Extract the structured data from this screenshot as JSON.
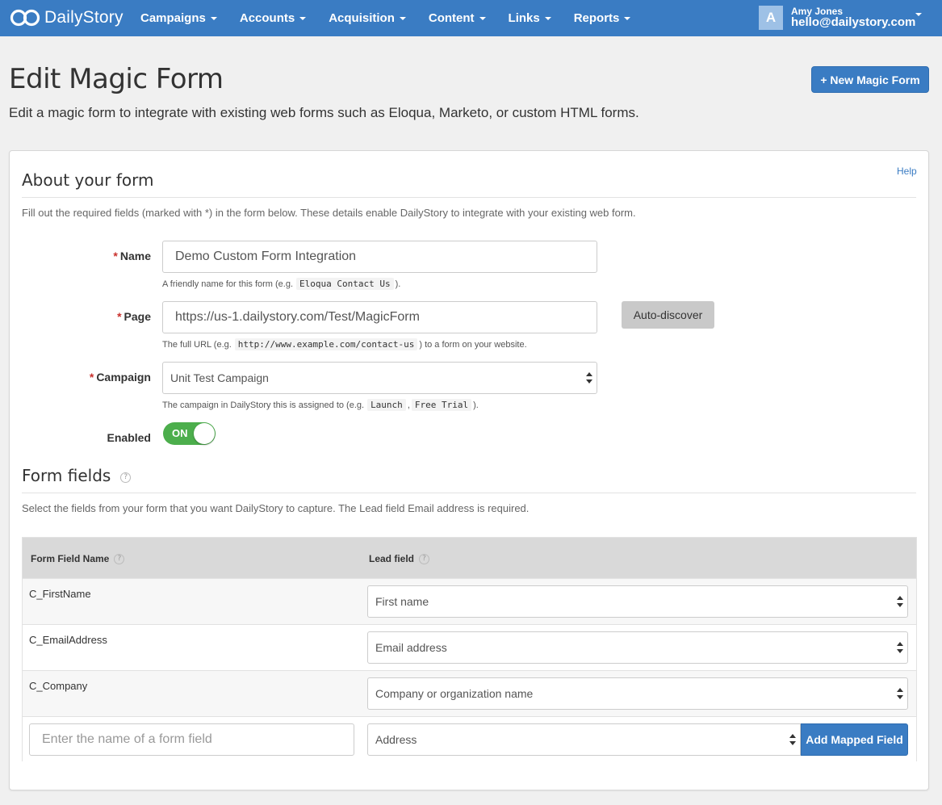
{
  "brand": {
    "name": "DailyStory",
    "logo_icon": "infinity-logo"
  },
  "nav": {
    "items": [
      {
        "label": "Campaigns"
      },
      {
        "label": "Accounts"
      },
      {
        "label": "Acquisition"
      },
      {
        "label": "Content"
      },
      {
        "label": "Links"
      },
      {
        "label": "Reports"
      }
    ]
  },
  "user": {
    "initial": "A",
    "name": "Amy Jones",
    "email": "hello@dailystory.com"
  },
  "header": {
    "title": "Edit Magic Form",
    "description": "Edit a magic form to integrate with existing web forms such as Eloqua, Marketo, or custom HTML forms.",
    "new_button": "+ New Magic Form"
  },
  "about": {
    "title": "About your form",
    "help": "Help",
    "description": "Fill out the required fields (marked with *) in the form below. These details enable DailyStory to integrate with your existing web form.",
    "required_mark": "*",
    "name": {
      "label": "Name",
      "value": "Demo Custom Form Integration",
      "hint_pre": "A friendly name for this form (e.g.",
      "hint_code": "Eloqua Contact Us",
      "hint_post": ")."
    },
    "page": {
      "label": "Page",
      "value": "https://us-1.dailystory.com/Test/MagicForm",
      "hint_pre": "The full URL (e.g.",
      "hint_code": "http://www.example.com/contact-us",
      "hint_post": ") to a form on your website.",
      "button": "Auto-discover"
    },
    "campaign": {
      "label": "Campaign",
      "value": "Unit Test Campaign",
      "hint_pre": "The campaign in DailyStory this is assigned to (e.g.",
      "hint_code1": "Launch",
      "hint_sep": ",",
      "hint_code2": "Free Trial",
      "hint_post": ")."
    },
    "enabled": {
      "label": "Enabled",
      "state": "ON"
    }
  },
  "fields": {
    "title": "Form fields",
    "help_glyph": "?",
    "description": "Select the fields from your form that you want DailyStory to capture. The Lead field Email address is required.",
    "columns": {
      "name": "Form Field Name",
      "lead": "Lead field"
    },
    "rows": [
      {
        "name": "C_FirstName",
        "lead": "First name"
      },
      {
        "name": "C_EmailAddress",
        "lead": "Email address"
      },
      {
        "name": "C_Company",
        "lead": "Company or organization name"
      }
    ],
    "add": {
      "placeholder": "Enter the name of a form field",
      "lead": "Address",
      "button": "Add Mapped Field"
    }
  }
}
